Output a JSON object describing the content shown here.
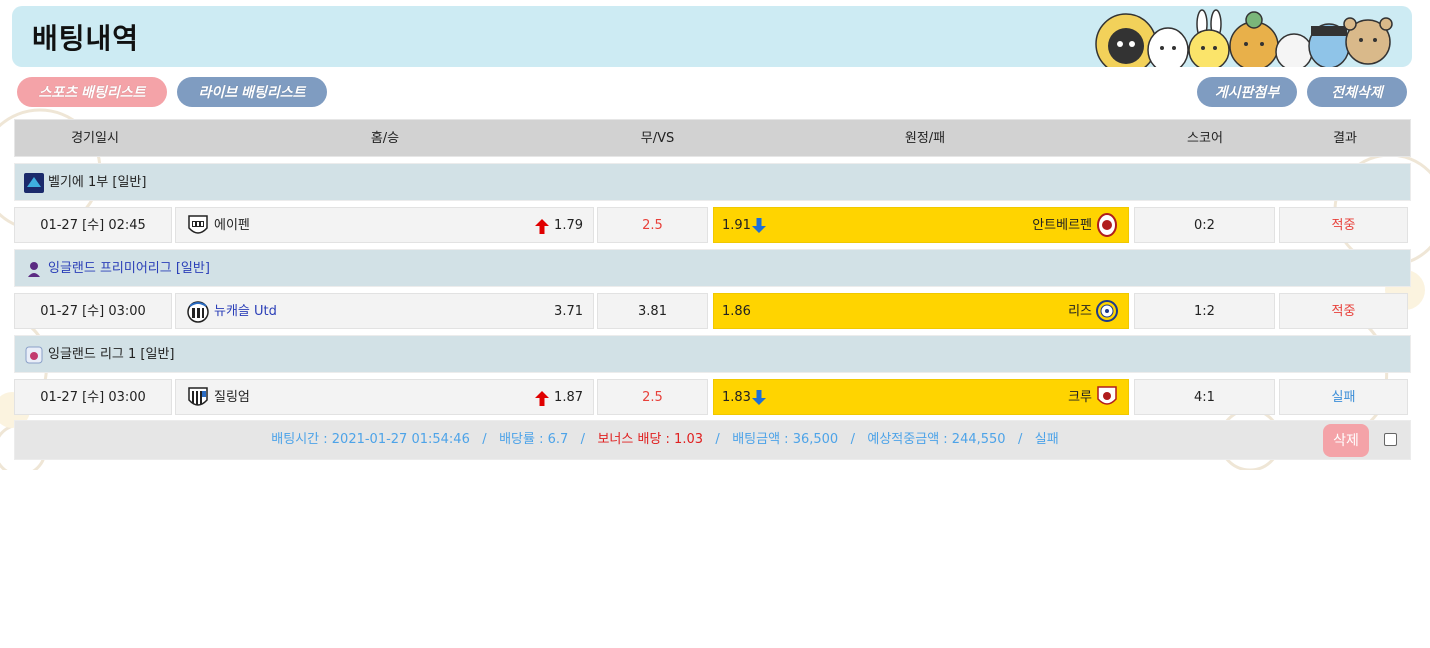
{
  "header": {
    "title": "배팅내역"
  },
  "tabs": {
    "sports": "스포츠 배팅리스트",
    "live": "라이브 배팅리스트",
    "board_attach": "게시판첨부",
    "delete_all": "전체삭제"
  },
  "columns": {
    "date": "경기일시",
    "home": "홈/승",
    "draw": "무/VS",
    "away": "원정/패",
    "score": "스코어",
    "result": "결과"
  },
  "matches": [
    {
      "league": "벨기에 1부 [일반]",
      "date": "01-27 [수] 02:45",
      "home_team": "에이펜",
      "home_odds": "1.79",
      "draw": "2.5",
      "away_odds": "1.91",
      "away_team": "안트베르펜",
      "score": "0:2",
      "result": "적중"
    },
    {
      "league": "잉글랜드 프리미어리그 [일반]",
      "date": "01-27 [수] 03:00",
      "home_team": "뉴캐슬 Utd",
      "home_odds": "3.71",
      "draw": "3.81",
      "away_odds": "1.86",
      "away_team": "리즈",
      "score": "1:2",
      "result": "적중"
    },
    {
      "league": "잉글랜드 리그 1 [일반]",
      "date": "01-27 [수] 03:00",
      "home_team": "질링엄",
      "home_odds": "1.87",
      "draw": "2.5",
      "away_odds": "1.83",
      "away_team": "크루",
      "score": "4:1",
      "result": "실패"
    }
  ],
  "summary": {
    "bet_time": "배팅시간 : 2021-01-27 01:54:46",
    "sep": "/",
    "odds": "배당률 : 6.7",
    "bonus": "보너스 배당 : 1.03",
    "amount": "배팅금액 : 36,500",
    "expected": "예상적중금액 : 244,550",
    "status": "실패",
    "delete_label": "삭제"
  },
  "colors": {
    "header_bg": "#cdebf3",
    "pink_button": "#f4a3a8",
    "blue_button": "#7f9cc1",
    "away_highlight": "#ffd400",
    "win_red": "#e8403a",
    "lose_blue": "#3d8fd8"
  }
}
